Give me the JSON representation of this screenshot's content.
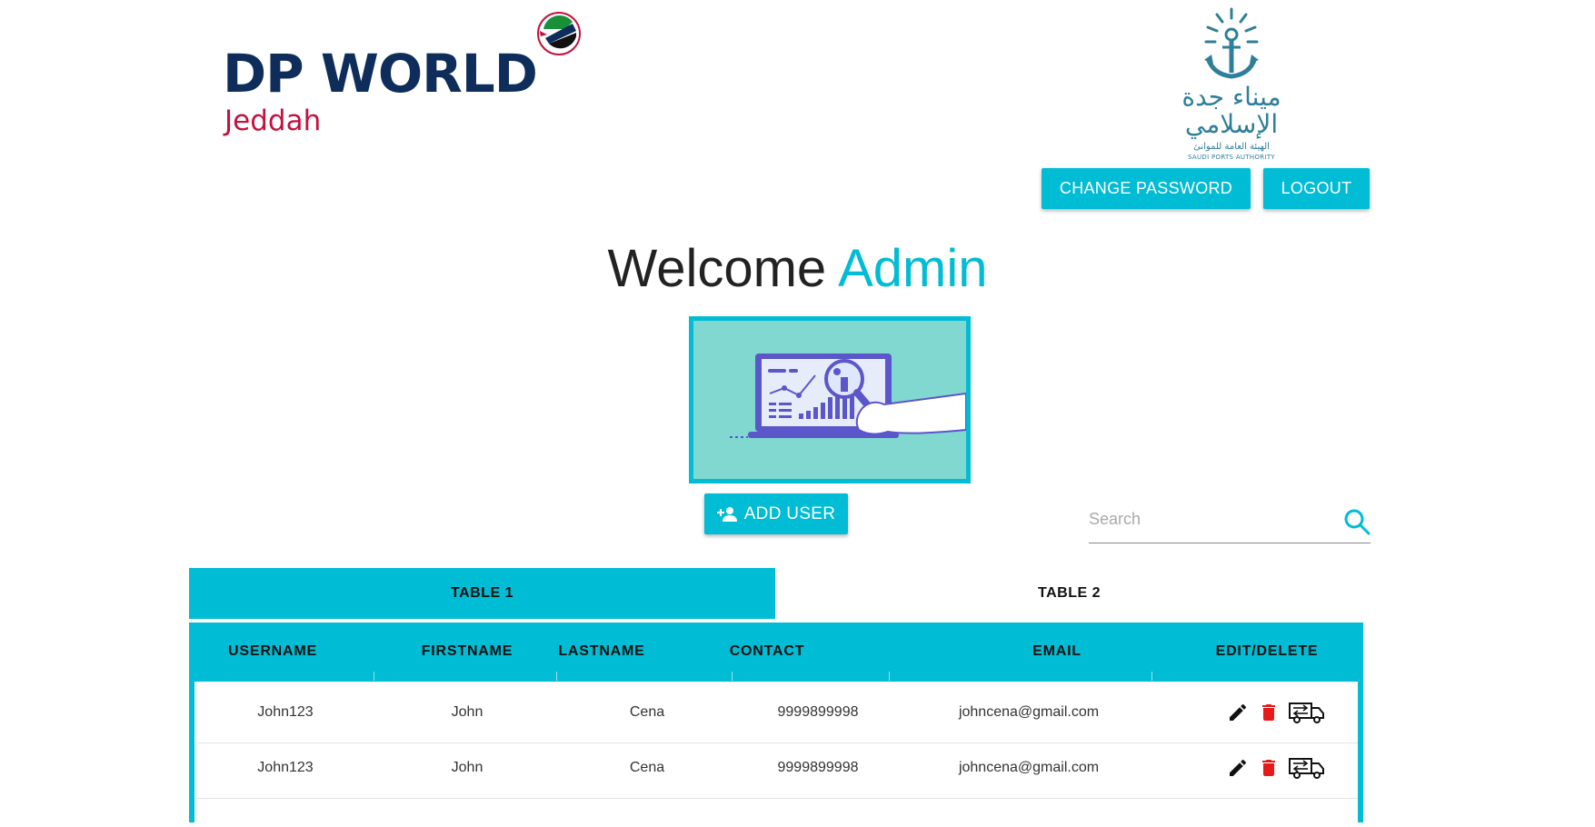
{
  "header": {
    "brand_name": "DP WORLD",
    "brand_city": "Jeddah",
    "port_name_ar_line1": "ميناء جدة",
    "port_name_ar_line2": "الإسلامي",
    "port_authority_ar": "الهيئة العامة للموانئ",
    "port_authority_en": "SAUDI PORTS AUTHORITY",
    "change_password_label": "CHANGE PASSWORD",
    "logout_label": "LOGOUT"
  },
  "welcome": {
    "greeting": "Welcome",
    "user": "Admin"
  },
  "toolbar": {
    "add_user_label": "ADD USER",
    "search_placeholder": "Search",
    "search_value": ""
  },
  "tabs": [
    {
      "label": "TABLE 1",
      "active": true
    },
    {
      "label": "TABLE 2",
      "active": false
    }
  ],
  "table": {
    "columns": [
      "USERNAME",
      "FIRSTNAME",
      "LASTNAME",
      "CONTACT",
      "EMAIL",
      "EDIT/DELETE"
    ],
    "rows": [
      {
        "username": "John123",
        "firstname": "John",
        "lastname": "Cena",
        "contact": "9999899998",
        "email": "johncena@gmail.com"
      },
      {
        "username": "John123",
        "firstname": "John",
        "lastname": "Cena",
        "contact": "9999899998",
        "email": "johncena@gmail.com"
      }
    ],
    "row_actions": [
      "edit-icon",
      "delete-icon",
      "truck-icon"
    ]
  },
  "colors": {
    "accent": "#00bcd4",
    "brand_navy": "#0e2d5b",
    "brand_red": "#c4123f",
    "delete_red": "#e81919"
  }
}
